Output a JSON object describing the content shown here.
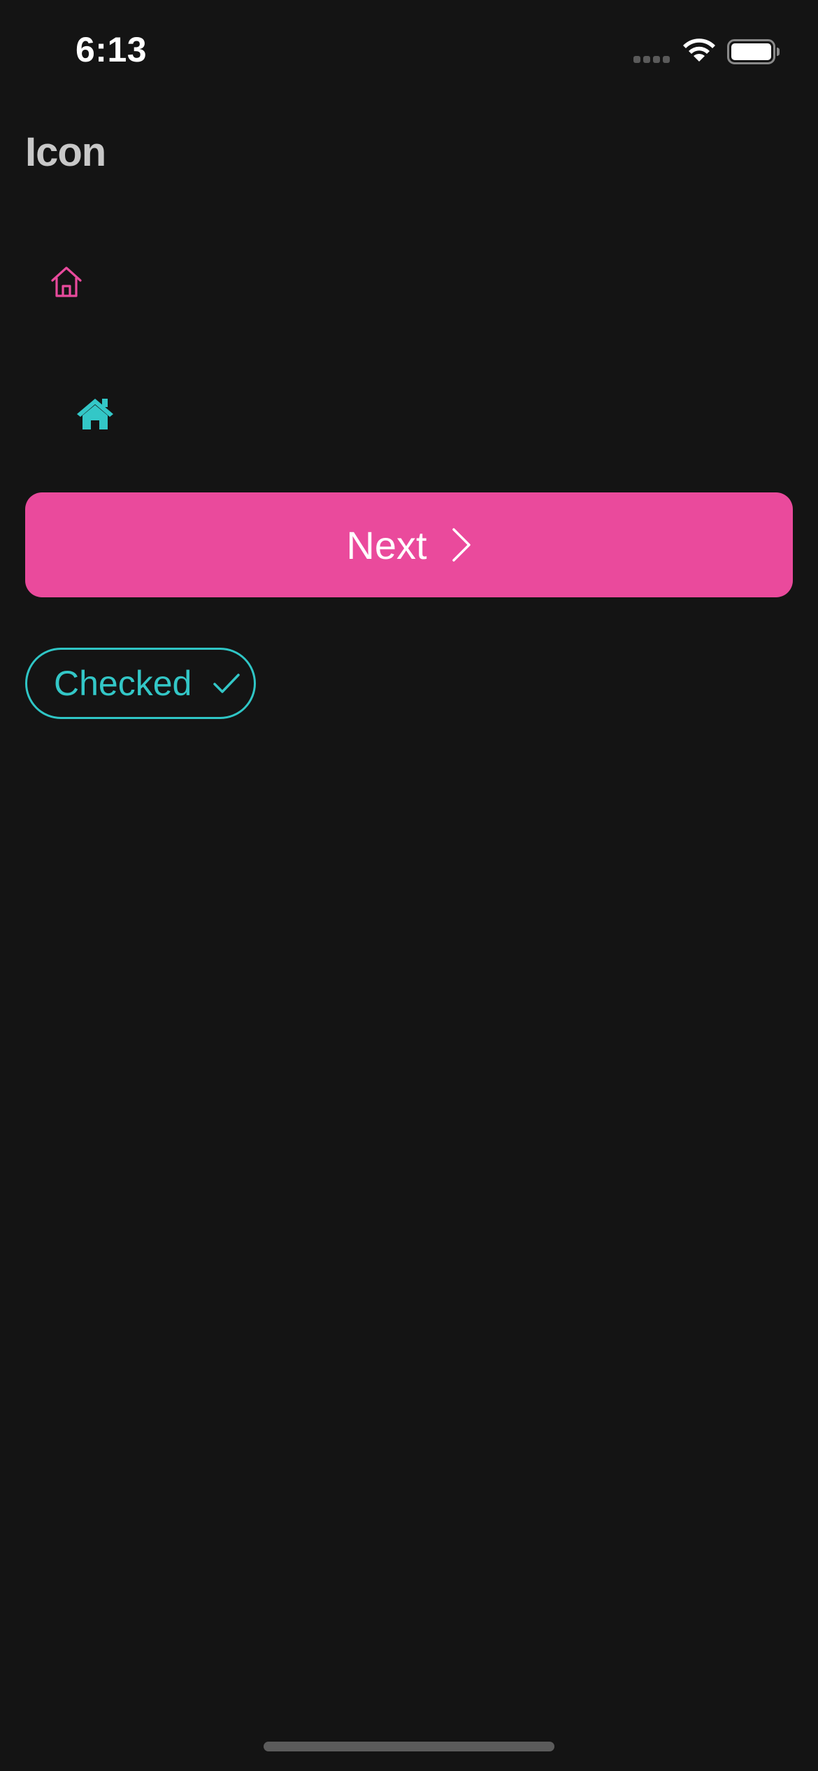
{
  "status_bar": {
    "time": "6:13",
    "signal_icon": "signal-bars-icon",
    "wifi_icon": "wifi-icon",
    "battery_icon": "battery-icon",
    "battery_level": 1.0
  },
  "header": {
    "title": "Icon"
  },
  "icons": {
    "outline": {
      "name": "home-outline-icon",
      "color": "#e84a9c"
    },
    "solid": {
      "name": "home-solid-icon",
      "color": "#33c7c7"
    }
  },
  "next_button": {
    "label": "Next",
    "icon": "chevron-right-icon",
    "background": "#ea4a9c"
  },
  "checked_chip": {
    "label": "Checked",
    "icon": "check-icon",
    "color": "#33c7c7"
  },
  "colors": {
    "background": "#141414",
    "title": "#c8c8c8",
    "accent_pink": "#ea4a9c",
    "accent_teal": "#33c7c7"
  }
}
